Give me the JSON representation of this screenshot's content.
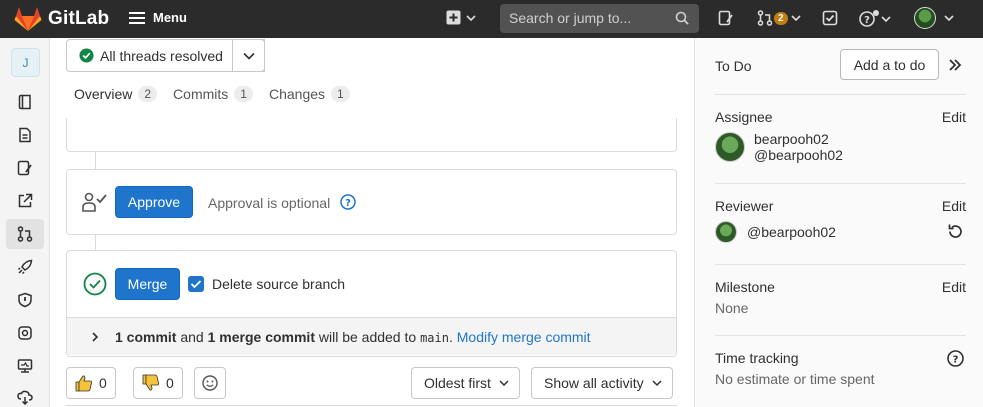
{
  "topbar": {
    "brand": "GitLab",
    "menu_label": "Menu",
    "search_placeholder": "Search or jump to...",
    "merge_requests_count": "2"
  },
  "sidebar": {
    "project_initial": "J"
  },
  "main": {
    "threads_status": "All threads resolved",
    "tabs": [
      {
        "label": "Overview",
        "count": "2"
      },
      {
        "label": "Commits",
        "count": "1"
      },
      {
        "label": "Changes",
        "count": "1"
      }
    ],
    "approve_button": "Approve",
    "approval_text": "Approval is optional",
    "merge_button": "Merge",
    "delete_source_branch_label": "Delete source branch",
    "commit_info": {
      "part1": "1 commit",
      "part2": " and ",
      "part3": "1 merge commit",
      "part4": " will be added to ",
      "branch": "main",
      "part5": ". ",
      "link": "Modify merge commit"
    },
    "thumbs_up_count": "0",
    "thumbs_down_count": "0",
    "sort_label": "Oldest first",
    "filter_label": "Show all activity"
  },
  "right_sidebar": {
    "todo_label": "To Do",
    "add_todo_button": "Add a to do",
    "assignee": {
      "label": "Assignee",
      "edit": "Edit",
      "name": "bearpooh02",
      "username": "@bearpooh02"
    },
    "reviewer": {
      "label": "Reviewer",
      "edit": "Edit",
      "username": "@bearpooh02"
    },
    "milestone": {
      "label": "Milestone",
      "edit": "Edit",
      "value": "None"
    },
    "time_tracking": {
      "label": "Time tracking",
      "value": "No estimate or time spent"
    }
  },
  "colors": {
    "topbar": "#2b2b2b",
    "primary": "#1f75cb",
    "success": "#108548",
    "badge": "#c17d10"
  }
}
